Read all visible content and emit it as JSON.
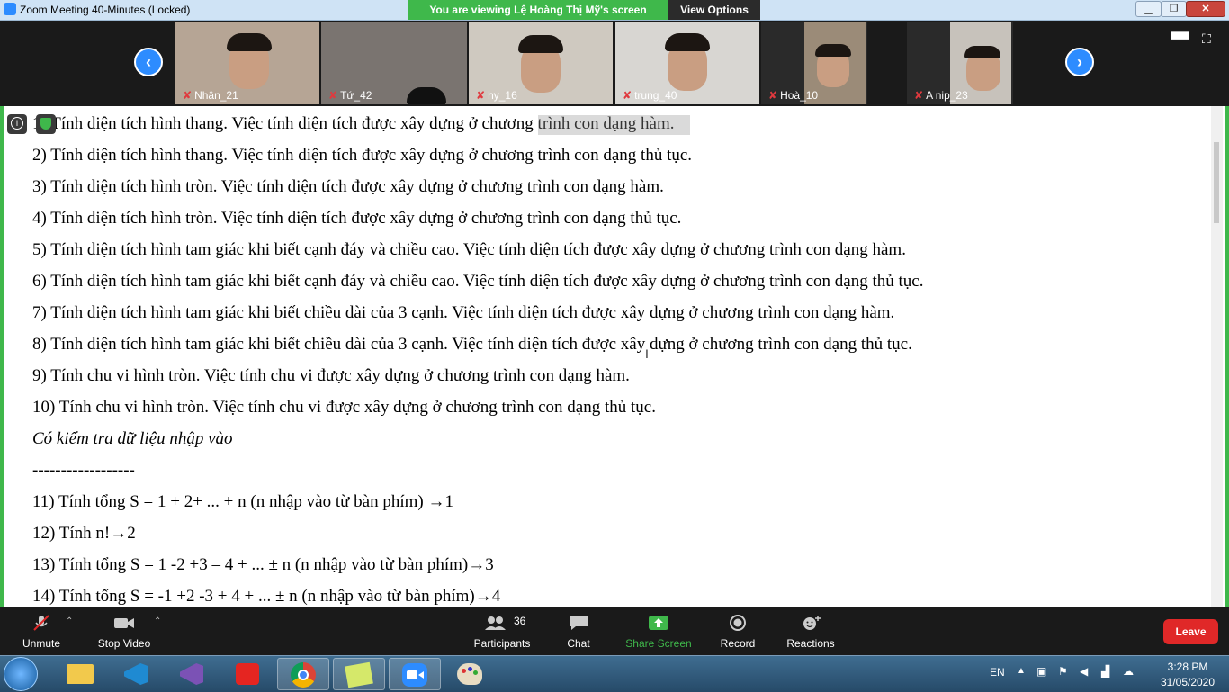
{
  "window": {
    "title": "Zoom Meeting 40-Minutes  (Locked)",
    "viewing_banner": "You are viewing Lệ Hoàng Thị Mỹ's screen",
    "view_options_label": "View Options",
    "minimize_icon": "minimize-icon",
    "maximize_icon": "maximize-icon",
    "close_icon": "close-icon"
  },
  "participants_strip": {
    "prev_icon": "chevron-left-icon",
    "next_icon": "chevron-right-icon",
    "tiles": [
      {
        "name": "Nhân_21"
      },
      {
        "name": "Tứ_42"
      },
      {
        "name": "hy_16"
      },
      {
        "name": "trung_40"
      },
      {
        "name": "Hoà_10"
      },
      {
        "name": "A nip_23"
      }
    ],
    "muted_icon": "mic-muted-icon"
  },
  "document": {
    "lines": [
      "1)  Tính diện tích hình thang. Việc tính diện tích được xây dựng ở chương trình con dạng hàm.",
      "2)  Tính diện tích hình thang. Việc tính diện tích được xây dựng ở chương trình con dạng thủ tục.",
      "3)  Tính diện tích hình tròn. Việc tính diện tích được xây dựng ở chương trình con dạng hàm.",
      "4)  Tính diện tích hình tròn. Việc tính diện tích được xây dựng ở chương trình con dạng thủ tục.",
      "5)  Tính diện tích hình tam giác khi biết cạnh đáy và chiều cao. Việc tính diện tích được xây dựng ở chương trình con dạng hàm.",
      "6)  Tính diện tích hình tam giác khi biết cạnh đáy và chiều cao. Việc tính diện tích được xây dựng ở chương trình con dạng thủ tục.",
      "7)  Tính diện tích hình tam giác khi biết chiều dài của 3 cạnh. Việc tính diện tích được xây dựng ở chương trình con dạng hàm.",
      "8)  Tính diện tích hình tam giác khi biết chiều dài của 3 cạnh. Việc tính diện tích được xây dựng ở chương trình con dạng thủ tục.",
      "9)  Tính chu vi hình tròn. Việc tính chu vi được xây dựng ở chương trình con dạng hàm.",
      "10) Tính chu vi hình tròn. Việc tính chu vi được xây dựng ở chương trình con dạng thủ tục.",
      "Có kiểm tra dữ liệu nhập vào",
      "------------------",
      "11) Tính tổng S = 1 +  2+ ... + n (n nhập vào từ bàn phím) →1",
      "12) Tính n!→2",
      "13) Tính tổng S = 1 -2  +3 – 4 +  ... ± n (n nhập vào từ bàn phím)→3",
      "14) Tính tổng S = -1 +2  -3 + 4 +  ... ± n (n nhập vào từ bàn phím)→4"
    ]
  },
  "toolbar": {
    "unmute_label": "Unmute",
    "stop_video_label": "Stop Video",
    "participants_label": "Participants",
    "participants_count": "36",
    "chat_label": "Chat",
    "share_screen_label": "Share Screen",
    "record_label": "Record",
    "reactions_label": "Reactions",
    "leave_label": "Leave",
    "share_color": "#3fb84b",
    "leave_color": "#e02828"
  },
  "taskbar": {
    "apps": [
      "start-orb",
      "file-explorer-icon",
      "vscode-icon",
      "visual-studio-icon",
      "garena-icon",
      "chrome-icon",
      "sticky-notes-icon",
      "zoom-icon",
      "paint-icon"
    ],
    "language": "EN",
    "time": "3:28 PM",
    "date": "31/05/2020"
  }
}
